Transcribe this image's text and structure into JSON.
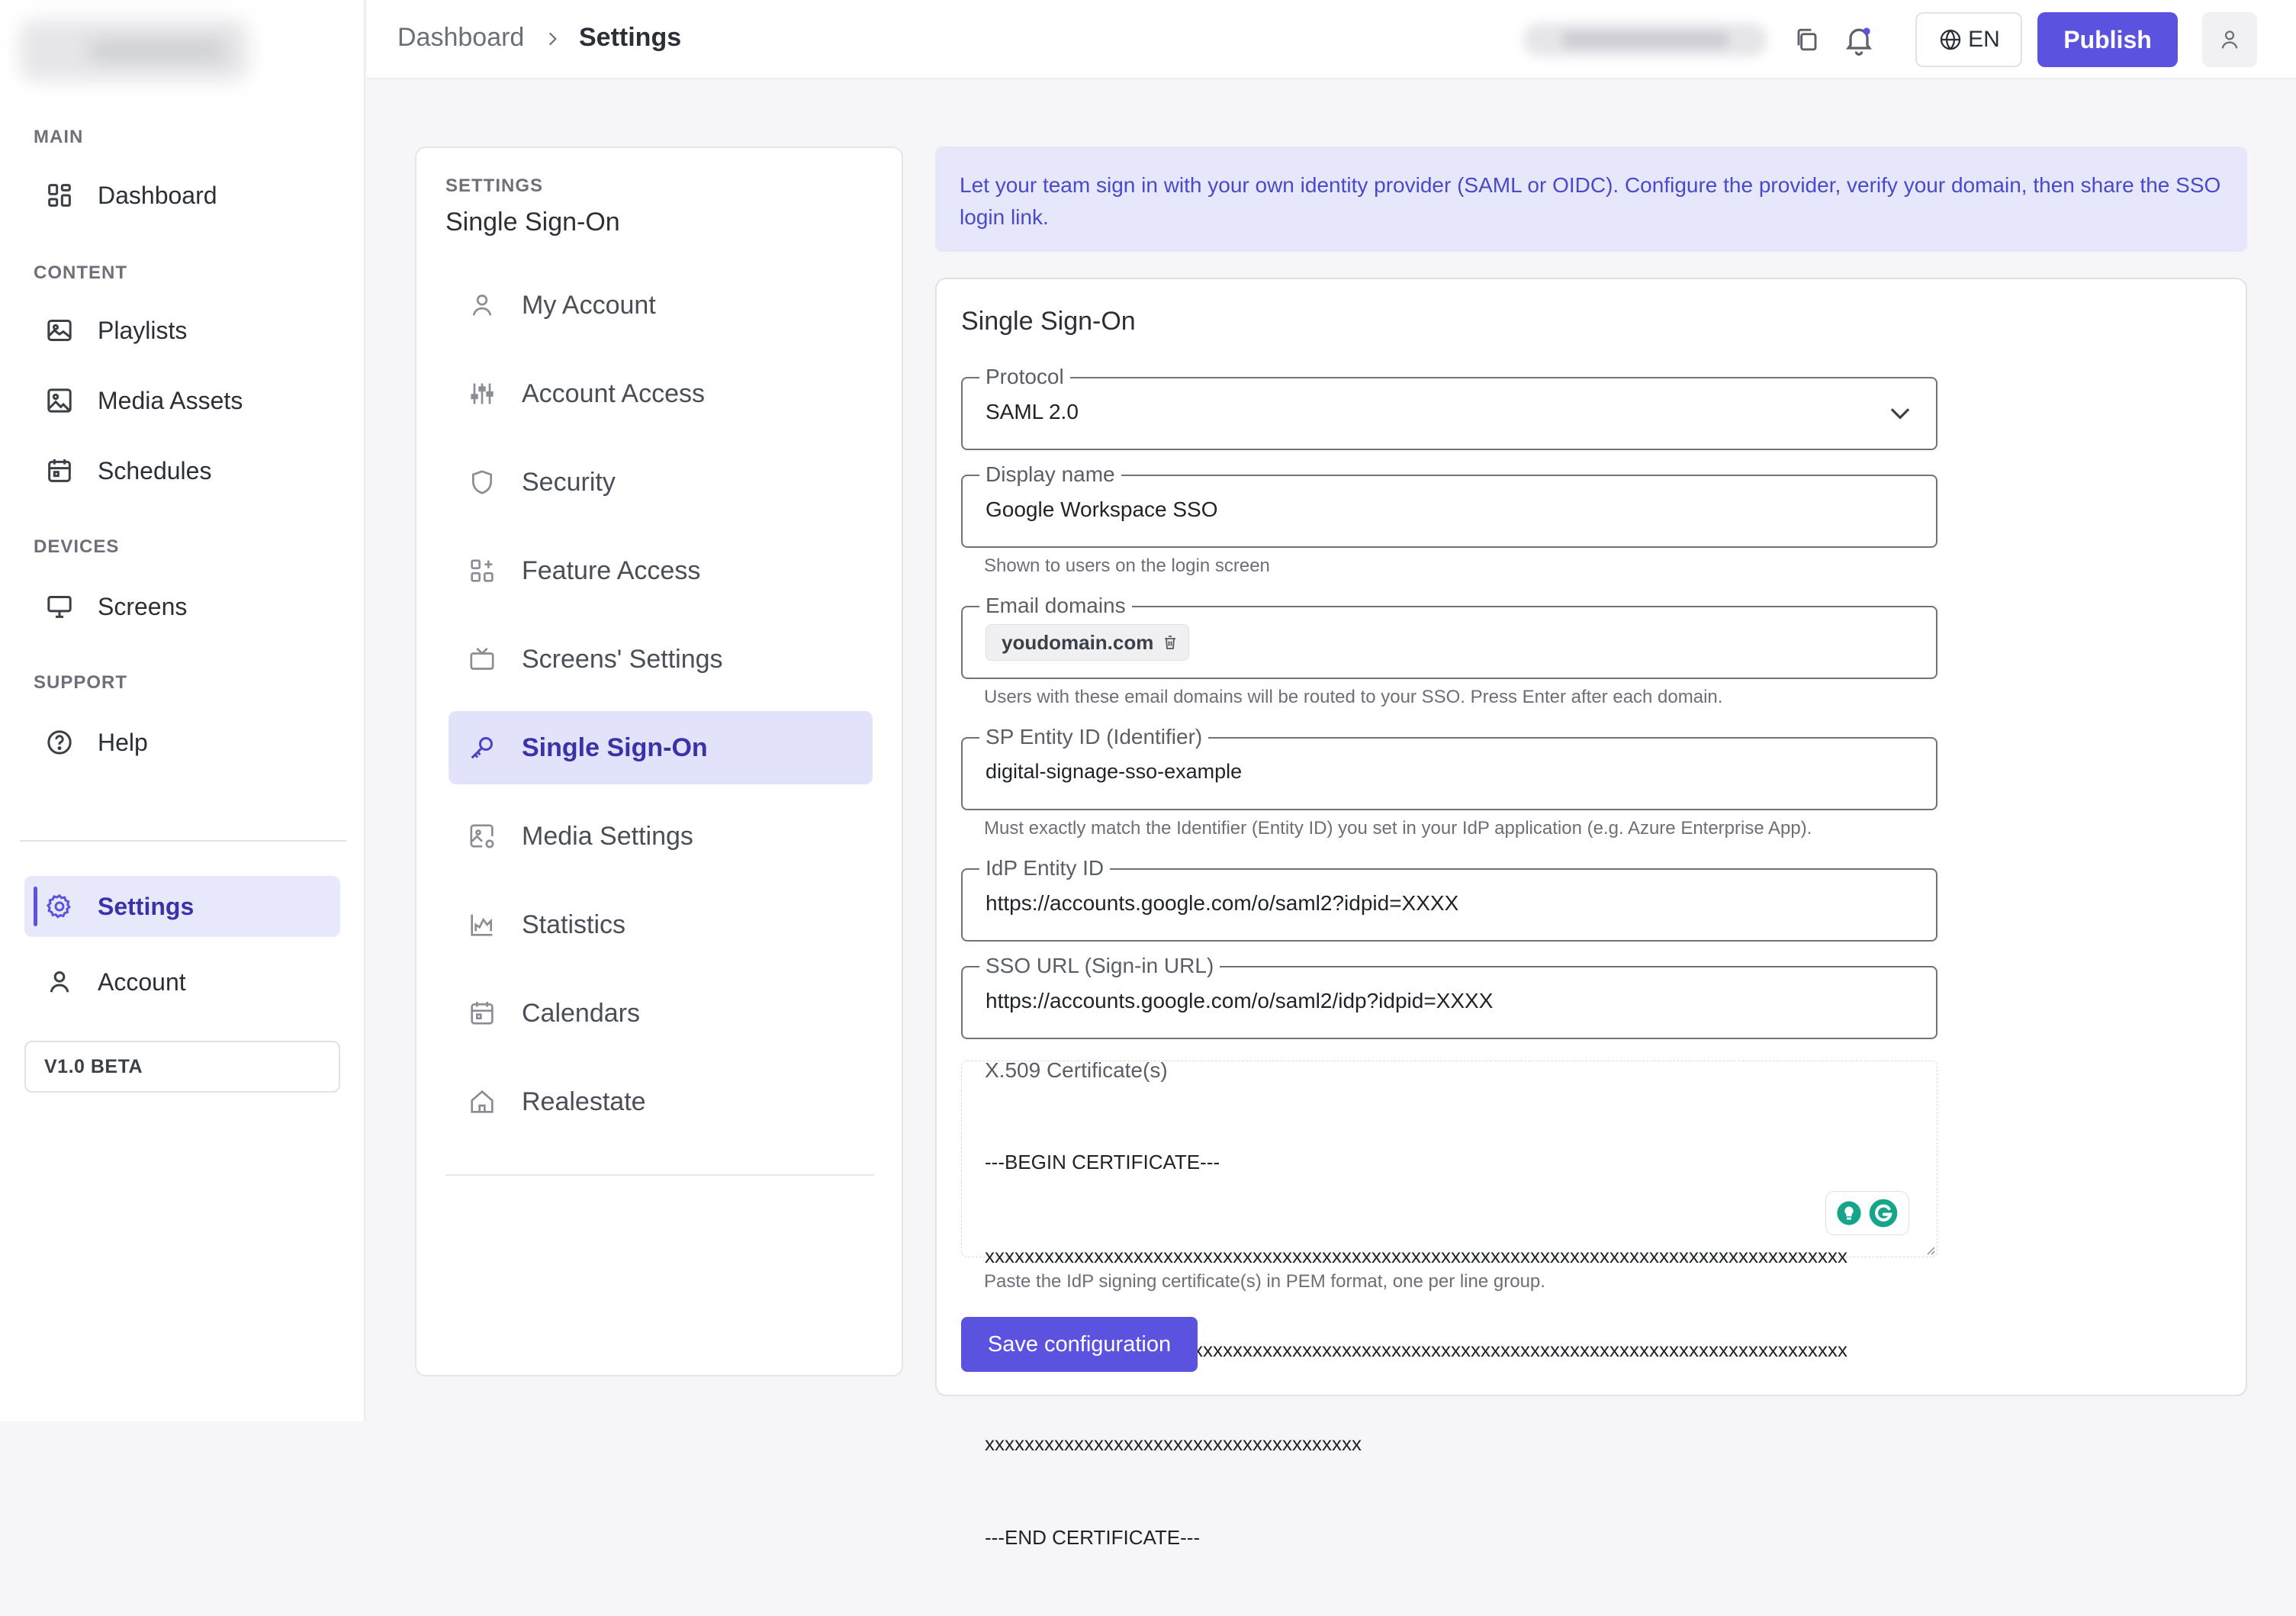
{
  "sidebar": {
    "sections": {
      "main": "MAIN",
      "content": "CONTENT",
      "devices": "DEVICES",
      "support": "SUPPORT"
    },
    "items": {
      "dashboard": "Dashboard",
      "playlists": "Playlists",
      "media_assets": "Media Assets",
      "schedules": "Schedules",
      "screens": "Screens",
      "help": "Help",
      "settings": "Settings",
      "account": "Account"
    },
    "version": "V1.0 BETA",
    "active": "settings"
  },
  "header": {
    "breadcrumb": [
      "Dashboard",
      "Settings"
    ],
    "language": "EN",
    "publish_label": "Publish"
  },
  "settings_menu": {
    "overline": "SETTINGS",
    "title": "Single Sign-On",
    "items": [
      "My Account",
      "Account Access",
      "Security",
      "Feature Access",
      "Screens' Settings",
      "Single Sign-On",
      "Media Settings",
      "Statistics",
      "Calendars",
      "Realestate"
    ],
    "active_index": 5
  },
  "info_banner": "Let your team sign in with your own identity provider (SAML or OIDC). Configure the provider, verify your domain, then share the SSO login link.",
  "sso_form": {
    "title": "Single Sign-On",
    "protocol": {
      "label": "Protocol",
      "value": "SAML 2.0"
    },
    "display_name": {
      "label": "Display name",
      "value": "Google Workspace SSO",
      "hint": "Shown to users on the login screen"
    },
    "email_domains": {
      "label": "Email domains",
      "chips": [
        "youdomain.com"
      ],
      "hint": "Users with these email domains will be routed to your SSO. Press Enter after each domain."
    },
    "sp_entity_id": {
      "label": "SP Entity ID (Identifier)",
      "value": "digital-signage-sso-example",
      "hint": "Must exactly match the Identifier (Entity ID) you set in your IdP application (e.g. Azure Enterprise App)."
    },
    "idp_entity_id": {
      "label": "IdP Entity ID",
      "value": "https://accounts.google.com/o/saml2?idpid=XXXX"
    },
    "sso_url": {
      "label": "SSO URL (Sign-in URL)",
      "value": "https://accounts.google.com/o/saml2/idp?idpid=XXXX"
    },
    "certificate": {
      "label": "X.509 Certificate(s)",
      "lines": [
        "---BEGIN CERTIFICATE---",
        "xxxxxxxxxxxxxxxxxxxxxxxxxxxxxxxxxxxxxxxxxxxxxxxxxxxxxxxxxxxxxxxxxxxxxxxxxxxxxxxxxxxxxxx",
        "xxxxxxxxxxxxxxxxxxxxxxxxxxxxxxxxxxxxxxxxxxxxxxxxxxxxxxxxxxxxxxxxxxxxxxxxxxxxxxxxxxxxxxx",
        "xxxxxxxxxxxxxxxxxxxxxxxxxxxxxxxxxxxxxx",
        "---END CERTIFICATE---"
      ],
      "hint": "Paste the IdP signing certificate(s) in PEM format, one per line group."
    },
    "save_label": "Save configuration"
  },
  "colors": {
    "accent": "#5b53e0",
    "active_bg": "#e3e2fb",
    "banner_bg": "#e7e7fb",
    "banner_text": "#4a49c9"
  }
}
